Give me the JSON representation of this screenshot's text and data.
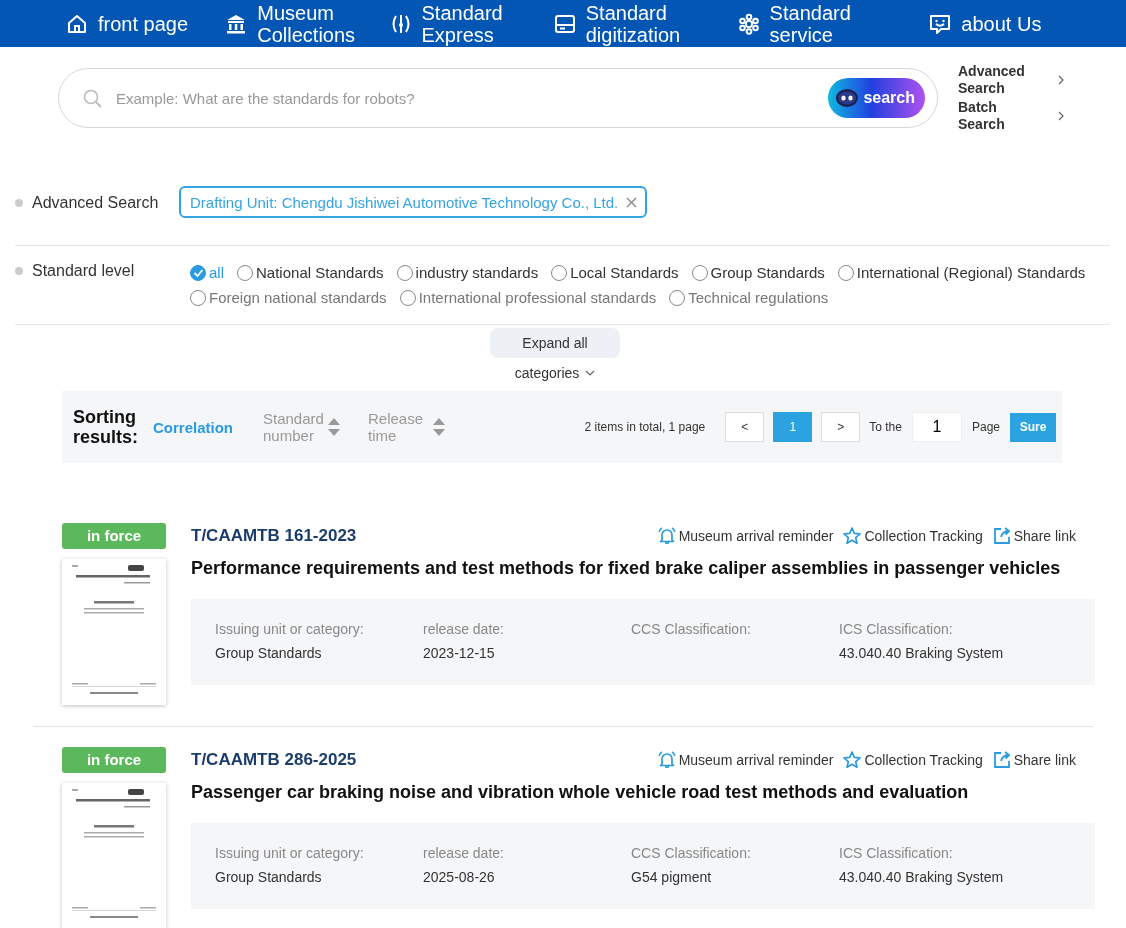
{
  "nav": [
    {
      "label": "front page"
    },
    {
      "label": "Museum Collections"
    },
    {
      "label": "Standard Express"
    },
    {
      "label": "Standard digitization"
    },
    {
      "label": "Standard service"
    },
    {
      "label": "about Us"
    }
  ],
  "search": {
    "placeholder": "Example: What are the standards for robots?",
    "button": "search",
    "links": [
      "Advanced Search",
      "Batch Search"
    ]
  },
  "filters": {
    "advanced": {
      "label": "Advanced Search",
      "tag": "Drafting Unit: Chengdu Jishiwei Automotive Technology Co., Ltd."
    },
    "level": {
      "label": "Standard level",
      "options": [
        {
          "label": "all",
          "selected": true,
          "disabled": false
        },
        {
          "label": "National Standards",
          "selected": false,
          "disabled": false
        },
        {
          "label": "industry standards",
          "selected": false,
          "disabled": false
        },
        {
          "label": "Local Standards",
          "selected": false,
          "disabled": false
        },
        {
          "label": "Group Standards",
          "selected": false,
          "disabled": false
        },
        {
          "label": "International (Regional) Standards",
          "selected": false,
          "disabled": false
        },
        {
          "label": "Foreign national standards",
          "selected": false,
          "disabled": true
        },
        {
          "label": "International professional standards",
          "selected": false,
          "disabled": true
        },
        {
          "label": "Technical regulations",
          "selected": false,
          "disabled": true
        }
      ]
    }
  },
  "expand": {
    "button": "Expand all",
    "categories": "categories"
  },
  "sorting": {
    "label": "Sorting results:",
    "options": [
      {
        "label": "Correlation",
        "kind": "plain",
        "selected": true
      },
      {
        "label": "Standard number",
        "kind": "sortable",
        "selected": false
      },
      {
        "label": "Release time",
        "kind": "sortable",
        "selected": false
      }
    ],
    "summary": "2 items in total, 1 page",
    "prev": "<",
    "pages": [
      {
        "label": "1",
        "selected": true
      }
    ],
    "next": ">",
    "goto_label": "To the",
    "goto_value": "1",
    "page_label": "Page",
    "confirm": "Sure"
  },
  "results": [
    {
      "status": "in force",
      "code": "T/CAAMTB 161-2023",
      "title": "Performance requirements and test methods for fixed brake caliper assemblies in passenger vehicles",
      "actions": [
        "Museum arrival reminder",
        "Collection Tracking",
        "Share link"
      ],
      "fields": [
        {
          "label": "Issuing unit or category:",
          "value": "Group Standards"
        },
        {
          "label": "release date:",
          "value": "2023-12-15"
        },
        {
          "label": "CCS Classification:"
        },
        {
          "label": "ICS Classification:",
          "value": "43.040.40 Braking System"
        }
      ]
    },
    {
      "status": "in force",
      "code": "T/CAAMTB 286-2025",
      "title": "Passenger car braking noise and vibration whole vehicle road test methods and evaluation",
      "actions": [
        "Museum arrival reminder",
        "Collection Tracking",
        "Share link"
      ],
      "fields": [
        {
          "label": "Issuing unit or category:",
          "value": "Group Standards"
        },
        {
          "label": "release date:",
          "value": "2025-08-26"
        },
        {
          "label": "CCS Classification:",
          "value": "G54 pigment"
        },
        {
          "label": "ICS Classification:",
          "value": "43.040.40 Braking System"
        }
      ]
    }
  ]
}
